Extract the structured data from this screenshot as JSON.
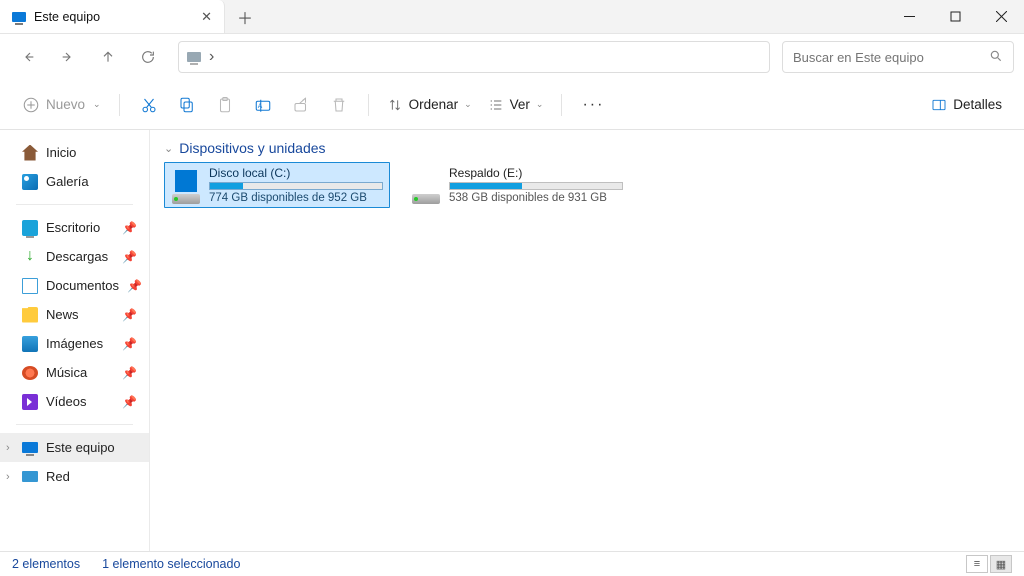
{
  "window": {
    "title": "Este equipo"
  },
  "search": {
    "placeholder": "Buscar en Este equipo"
  },
  "toolbar": {
    "new": "Nuevo",
    "sort": "Ordenar",
    "view": "Ver",
    "details": "Detalles"
  },
  "sidebar": {
    "home": "Inicio",
    "gallery": "Galería",
    "desktop": "Escritorio",
    "downloads": "Descargas",
    "documents": "Documentos",
    "news": "News",
    "images": "Imágenes",
    "music": "Música",
    "videos": "Vídeos",
    "thispc": "Este equipo",
    "network": "Red"
  },
  "group": {
    "header": "Dispositivos y unidades"
  },
  "drives": [
    {
      "name": "Disco local (C:)",
      "space": "774 GB disponibles de 952 GB",
      "used_pct": 19,
      "primary": true,
      "selected": true
    },
    {
      "name": "Respaldo (E:)",
      "space": "538 GB disponibles de 931 GB",
      "used_pct": 42,
      "primary": false,
      "selected": false
    }
  ],
  "status": {
    "count": "2 elementos",
    "selection": "1 elemento seleccionado"
  }
}
